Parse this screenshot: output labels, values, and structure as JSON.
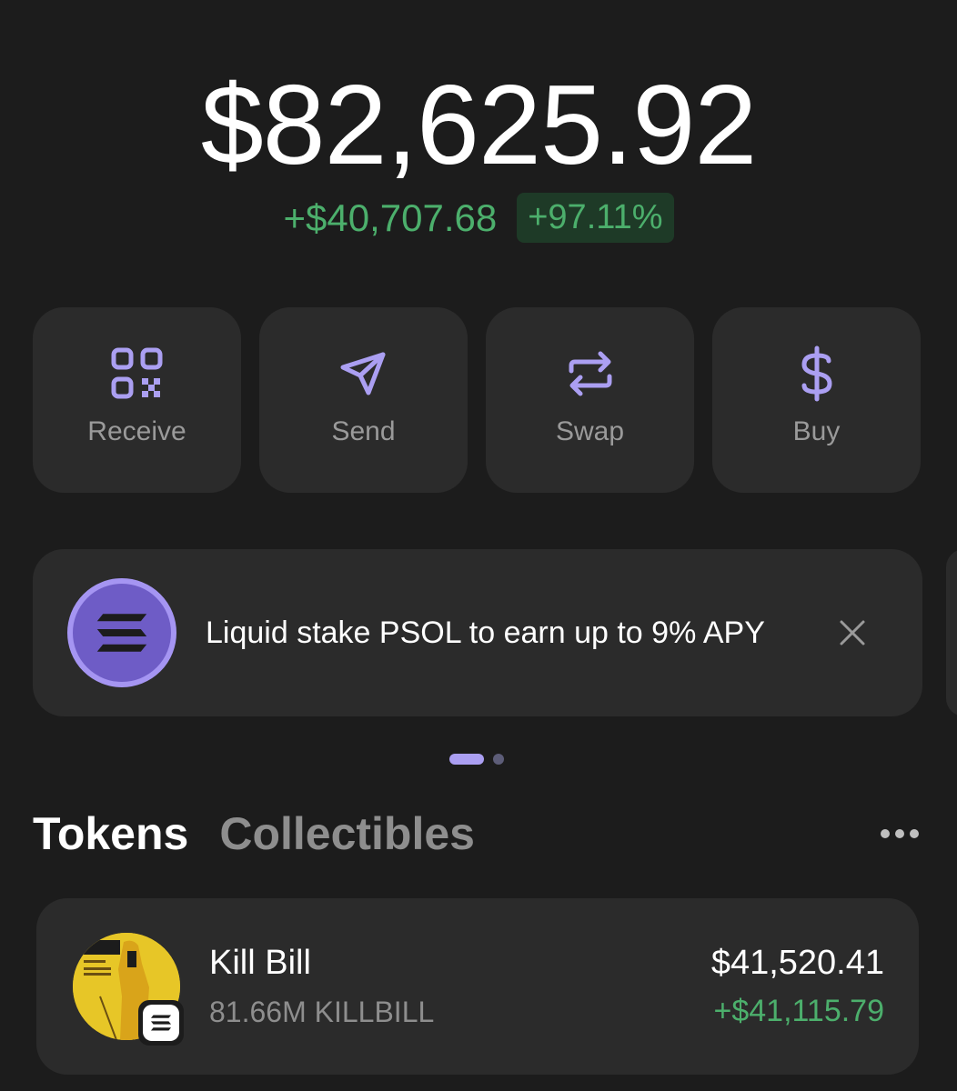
{
  "balance": {
    "total": "$82,625.92",
    "change_amount": "+$40,707.68",
    "change_percent": "+97.11%"
  },
  "actions": [
    {
      "label": "Receive",
      "icon": "qr-code-icon"
    },
    {
      "label": "Send",
      "icon": "send-icon"
    },
    {
      "label": "Swap",
      "icon": "swap-icon"
    },
    {
      "label": "Buy",
      "icon": "dollar-icon"
    }
  ],
  "banner": {
    "text": "Liquid stake PSOL to earn up to 9% APY",
    "icon": "solana-icon"
  },
  "carousel": {
    "active_index": 0,
    "count": 2
  },
  "tabs": [
    {
      "label": "Tokens",
      "active": true
    },
    {
      "label": "Collectibles",
      "active": false
    }
  ],
  "tokens": [
    {
      "name": "Kill Bill",
      "amount": "81.66M KILLBILL",
      "value": "$41,520.41",
      "change": "+$41,115.79",
      "chain_icon": "solana-icon"
    }
  ],
  "colors": {
    "background": "#1c1c1c",
    "card": "#2b2b2b",
    "accent": "#ab9ff2",
    "positive": "#4caf6c"
  }
}
